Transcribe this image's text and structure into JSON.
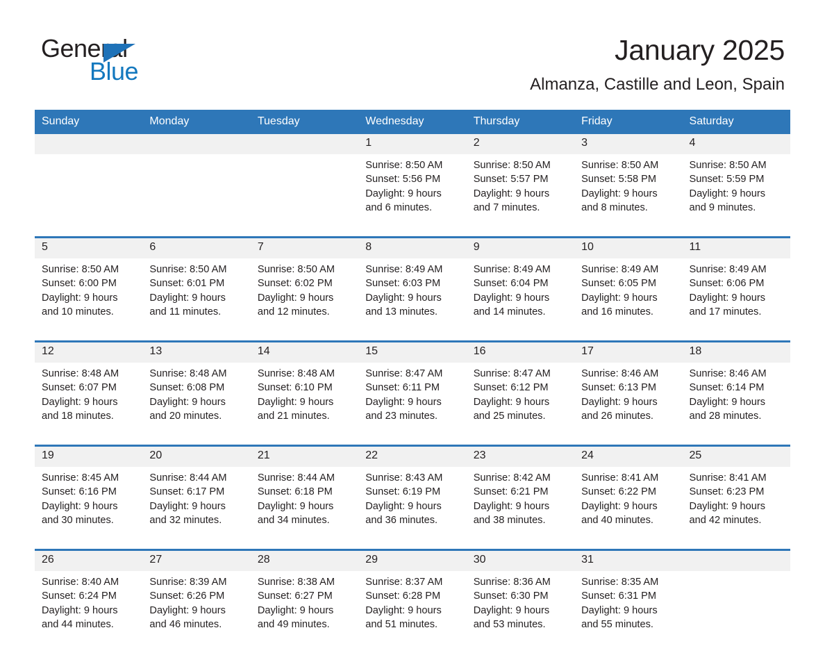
{
  "logo": {
    "word1": "General",
    "word2": "Blue",
    "triangle_icon": "logo-triangle-icon",
    "brand_black": "#231f20",
    "brand_blue": "#1378be"
  },
  "header": {
    "month_title": "January 2025",
    "location": "Almanza, Castille and Leon, Spain"
  },
  "theme": {
    "header_bar": "#2e77b8",
    "daynum_band": "#f1f1f1",
    "cell_background": "#ffffff",
    "text": "#231f20"
  },
  "weekday_headers": [
    "Sunday",
    "Monday",
    "Tuesday",
    "Wednesday",
    "Thursday",
    "Friday",
    "Saturday"
  ],
  "weeks": [
    {
      "days": [
        {
          "date": "",
          "lines": []
        },
        {
          "date": "",
          "lines": []
        },
        {
          "date": "",
          "lines": []
        },
        {
          "date": "1",
          "lines": [
            "Sunrise: 8:50 AM",
            "Sunset: 5:56 PM",
            "Daylight: 9 hours",
            "and 6 minutes."
          ]
        },
        {
          "date": "2",
          "lines": [
            "Sunrise: 8:50 AM",
            "Sunset: 5:57 PM",
            "Daylight: 9 hours",
            "and 7 minutes."
          ]
        },
        {
          "date": "3",
          "lines": [
            "Sunrise: 8:50 AM",
            "Sunset: 5:58 PM",
            "Daylight: 9 hours",
            "and 8 minutes."
          ]
        },
        {
          "date": "4",
          "lines": [
            "Sunrise: 8:50 AM",
            "Sunset: 5:59 PM",
            "Daylight: 9 hours",
            "and 9 minutes."
          ]
        }
      ]
    },
    {
      "days": [
        {
          "date": "5",
          "lines": [
            "Sunrise: 8:50 AM",
            "Sunset: 6:00 PM",
            "Daylight: 9 hours",
            "and 10 minutes."
          ]
        },
        {
          "date": "6",
          "lines": [
            "Sunrise: 8:50 AM",
            "Sunset: 6:01 PM",
            "Daylight: 9 hours",
            "and 11 minutes."
          ]
        },
        {
          "date": "7",
          "lines": [
            "Sunrise: 8:50 AM",
            "Sunset: 6:02 PM",
            "Daylight: 9 hours",
            "and 12 minutes."
          ]
        },
        {
          "date": "8",
          "lines": [
            "Sunrise: 8:49 AM",
            "Sunset: 6:03 PM",
            "Daylight: 9 hours",
            "and 13 minutes."
          ]
        },
        {
          "date": "9",
          "lines": [
            "Sunrise: 8:49 AM",
            "Sunset: 6:04 PM",
            "Daylight: 9 hours",
            "and 14 minutes."
          ]
        },
        {
          "date": "10",
          "lines": [
            "Sunrise: 8:49 AM",
            "Sunset: 6:05 PM",
            "Daylight: 9 hours",
            "and 16 minutes."
          ]
        },
        {
          "date": "11",
          "lines": [
            "Sunrise: 8:49 AM",
            "Sunset: 6:06 PM",
            "Daylight: 9 hours",
            "and 17 minutes."
          ]
        }
      ]
    },
    {
      "days": [
        {
          "date": "12",
          "lines": [
            "Sunrise: 8:48 AM",
            "Sunset: 6:07 PM",
            "Daylight: 9 hours",
            "and 18 minutes."
          ]
        },
        {
          "date": "13",
          "lines": [
            "Sunrise: 8:48 AM",
            "Sunset: 6:08 PM",
            "Daylight: 9 hours",
            "and 20 minutes."
          ]
        },
        {
          "date": "14",
          "lines": [
            "Sunrise: 8:48 AM",
            "Sunset: 6:10 PM",
            "Daylight: 9 hours",
            "and 21 minutes."
          ]
        },
        {
          "date": "15",
          "lines": [
            "Sunrise: 8:47 AM",
            "Sunset: 6:11 PM",
            "Daylight: 9 hours",
            "and 23 minutes."
          ]
        },
        {
          "date": "16",
          "lines": [
            "Sunrise: 8:47 AM",
            "Sunset: 6:12 PM",
            "Daylight: 9 hours",
            "and 25 minutes."
          ]
        },
        {
          "date": "17",
          "lines": [
            "Sunrise: 8:46 AM",
            "Sunset: 6:13 PM",
            "Daylight: 9 hours",
            "and 26 minutes."
          ]
        },
        {
          "date": "18",
          "lines": [
            "Sunrise: 8:46 AM",
            "Sunset: 6:14 PM",
            "Daylight: 9 hours",
            "and 28 minutes."
          ]
        }
      ]
    },
    {
      "days": [
        {
          "date": "19",
          "lines": [
            "Sunrise: 8:45 AM",
            "Sunset: 6:16 PM",
            "Daylight: 9 hours",
            "and 30 minutes."
          ]
        },
        {
          "date": "20",
          "lines": [
            "Sunrise: 8:44 AM",
            "Sunset: 6:17 PM",
            "Daylight: 9 hours",
            "and 32 minutes."
          ]
        },
        {
          "date": "21",
          "lines": [
            "Sunrise: 8:44 AM",
            "Sunset: 6:18 PM",
            "Daylight: 9 hours",
            "and 34 minutes."
          ]
        },
        {
          "date": "22",
          "lines": [
            "Sunrise: 8:43 AM",
            "Sunset: 6:19 PM",
            "Daylight: 9 hours",
            "and 36 minutes."
          ]
        },
        {
          "date": "23",
          "lines": [
            "Sunrise: 8:42 AM",
            "Sunset: 6:21 PM",
            "Daylight: 9 hours",
            "and 38 minutes."
          ]
        },
        {
          "date": "24",
          "lines": [
            "Sunrise: 8:41 AM",
            "Sunset: 6:22 PM",
            "Daylight: 9 hours",
            "and 40 minutes."
          ]
        },
        {
          "date": "25",
          "lines": [
            "Sunrise: 8:41 AM",
            "Sunset: 6:23 PM",
            "Daylight: 9 hours",
            "and 42 minutes."
          ]
        }
      ]
    },
    {
      "days": [
        {
          "date": "26",
          "lines": [
            "Sunrise: 8:40 AM",
            "Sunset: 6:24 PM",
            "Daylight: 9 hours",
            "and 44 minutes."
          ]
        },
        {
          "date": "27",
          "lines": [
            "Sunrise: 8:39 AM",
            "Sunset: 6:26 PM",
            "Daylight: 9 hours",
            "and 46 minutes."
          ]
        },
        {
          "date": "28",
          "lines": [
            "Sunrise: 8:38 AM",
            "Sunset: 6:27 PM",
            "Daylight: 9 hours",
            "and 49 minutes."
          ]
        },
        {
          "date": "29",
          "lines": [
            "Sunrise: 8:37 AM",
            "Sunset: 6:28 PM",
            "Daylight: 9 hours",
            "and 51 minutes."
          ]
        },
        {
          "date": "30",
          "lines": [
            "Sunrise: 8:36 AM",
            "Sunset: 6:30 PM",
            "Daylight: 9 hours",
            "and 53 minutes."
          ]
        },
        {
          "date": "31",
          "lines": [
            "Sunrise: 8:35 AM",
            "Sunset: 6:31 PM",
            "Daylight: 9 hours",
            "and 55 minutes."
          ]
        },
        {
          "date": "",
          "lines": []
        }
      ]
    }
  ]
}
